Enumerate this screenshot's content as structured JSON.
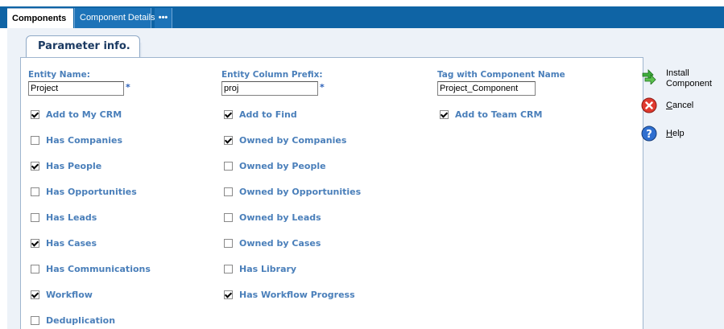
{
  "tabs": {
    "components": "Components",
    "component_details": "Component Details",
    "more": "•••"
  },
  "section_tab": "Parameter info.",
  "fields": {
    "entity_name": {
      "label": "Entity Name:",
      "value": "Project",
      "required": "*"
    },
    "entity_column_prefix": {
      "label": "Entity Column Prefix:",
      "value": "proj",
      "required": "*"
    },
    "tag_with_component_name": {
      "label": "Tag with Component Name",
      "value": "Project_Component"
    }
  },
  "checkboxes": {
    "col1": [
      {
        "label": "Add to My CRM",
        "checked": true
      },
      {
        "label": "Has Companies",
        "checked": false
      },
      {
        "label": "Has People",
        "checked": true
      },
      {
        "label": "Has Opportunities",
        "checked": false
      },
      {
        "label": "Has Leads",
        "checked": false
      },
      {
        "label": "Has Cases",
        "checked": true
      },
      {
        "label": "Has Communications",
        "checked": false
      },
      {
        "label": "Workflow",
        "checked": true
      },
      {
        "label": "Deduplication",
        "checked": false
      }
    ],
    "col2": [
      {
        "label": "Add to Find",
        "checked": true
      },
      {
        "label": "Owned by Companies",
        "checked": true
      },
      {
        "label": "Owned by People",
        "checked": false
      },
      {
        "label": "Owned by Opportunities",
        "checked": false
      },
      {
        "label": "Owned by Leads",
        "checked": false
      },
      {
        "label": "Owned by Cases",
        "checked": false
      },
      {
        "label": "Has Library",
        "checked": false
      },
      {
        "label": "Has Workflow Progress",
        "checked": true
      }
    ],
    "col3": [
      {
        "label": "Add to Team CRM",
        "checked": true
      }
    ]
  },
  "actions": {
    "install_line1": "Install",
    "install_line2": "Component",
    "cancel": "Cancel",
    "help": "Help"
  },
  "colors": {
    "tabbar": "#0f64a5",
    "label_blue": "#4a7fba",
    "panel_bg": "#edf2f8"
  }
}
